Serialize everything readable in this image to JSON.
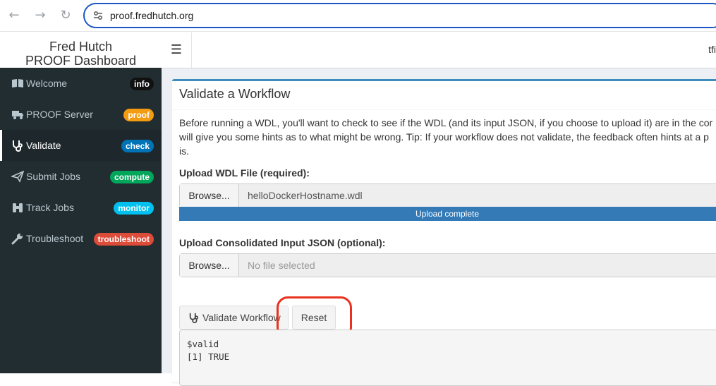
{
  "browser": {
    "url": "proof.fredhutch.org",
    "back_icon": "arrow-left-icon",
    "forward_icon": "arrow-right-icon",
    "reload_icon": "reload-icon"
  },
  "app": {
    "brand_line1": "Fred Hutch",
    "brand_line2": "PROOF Dashboard",
    "user_text": "tfi"
  },
  "sidebar": {
    "items": [
      {
        "label": "Welcome",
        "badge": "info",
        "badge_color": "#111111",
        "icon": "book-icon"
      },
      {
        "label": "PROOF Server",
        "badge": "proof",
        "badge_color": "#f39c12",
        "icon": "truck-icon"
      },
      {
        "label": "Validate",
        "badge": "check",
        "badge_color": "#0073b7",
        "icon": "stethoscope-icon",
        "active": true
      },
      {
        "label": "Submit Jobs",
        "badge": "compute",
        "badge_color": "#00a65a",
        "icon": "paper-plane-icon"
      },
      {
        "label": "Track Jobs",
        "badge": "monitor",
        "badge_color": "#00c0ef",
        "icon": "binoculars-icon"
      },
      {
        "label": "Troubleshoot",
        "badge": "troubleshoot",
        "badge_color": "#dd4b39",
        "icon": "wrench-icon"
      }
    ]
  },
  "main": {
    "title": "Validate a Workflow",
    "intro_line1": "Before running a WDL, you'll want to check to see if the WDL (and its input JSON, if you choose to upload it) are in the cor",
    "intro_line2": "will give you some hints as to what might be wrong. Tip: If your workflow does not validate, the feedback often hints at a p",
    "intro_line3": "is.",
    "wdl_label": "Upload WDL File (required):",
    "wdl_browse": "Browse...",
    "wdl_file": "helloDockerHostname.wdl",
    "upload_status": "Upload complete",
    "upload_progress": 1.0,
    "json_label": "Upload Consolidated Input JSON (optional):",
    "json_browse": "Browse...",
    "json_placeholder": "No file selected",
    "validate_button": "Validate Workflow",
    "reset_button": "Reset",
    "output_line1": "$valid",
    "output_line2": "[1] TRUE"
  }
}
